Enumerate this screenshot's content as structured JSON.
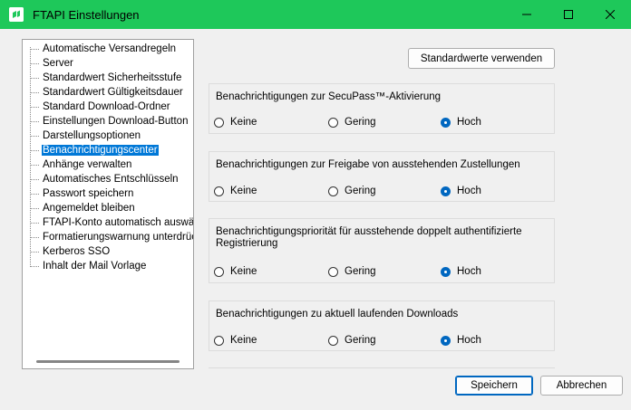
{
  "window": {
    "title": "FTAPI Einstellungen",
    "accent_color": "#1ec85a"
  },
  "tree": {
    "items": [
      {
        "label": "Automatische Versandregeln"
      },
      {
        "label": "Server"
      },
      {
        "label": "Standardwert Sicherheitsstufe"
      },
      {
        "label": "Standardwert Gültigkeitsdauer"
      },
      {
        "label": "Standard Download-Ordner"
      },
      {
        "label": "Einstellungen Download-Button"
      },
      {
        "label": "Darstellungsoptionen"
      },
      {
        "label": "Benachrichtigungscenter"
      },
      {
        "label": "Anhänge verwalten"
      },
      {
        "label": "Automatisches Entschlüsseln"
      },
      {
        "label": "Passwort speichern"
      },
      {
        "label": "Angemeldet bleiben"
      },
      {
        "label": "FTAPI-Konto automatisch auswählen"
      },
      {
        "label": "Formatierungswarnung unterdrücken"
      },
      {
        "label": "Kerberos SSO"
      },
      {
        "label": "Inhalt der Mail Vorlage"
      }
    ],
    "selected_index": 7,
    "selected_color": "#0078d7"
  },
  "toolbar": {
    "defaults_label": "Standardwerte verwenden"
  },
  "groups": [
    {
      "title": "Benachrichtigungen zur SecuPass™-Aktivierung",
      "options": [
        "Keine",
        "Gering",
        "Hoch"
      ],
      "selected": "Hoch"
    },
    {
      "title": "Benachrichtigungen zur Freigabe von ausstehenden Zustellungen",
      "options": [
        "Keine",
        "Gering",
        "Hoch"
      ],
      "selected": "Hoch"
    },
    {
      "title": "Benachrichtigungspriorität für ausstehende doppelt authentifizierte Registrierung",
      "options": [
        "Keine",
        "Gering",
        "Hoch"
      ],
      "selected": "Hoch"
    },
    {
      "title": "Benachrichtigungen zu aktuell laufenden Downloads",
      "options": [
        "Keine",
        "Gering",
        "Hoch"
      ],
      "selected": "Hoch"
    }
  ],
  "footer": {
    "save_label": "Speichern",
    "cancel_label": "Abbrechen"
  }
}
